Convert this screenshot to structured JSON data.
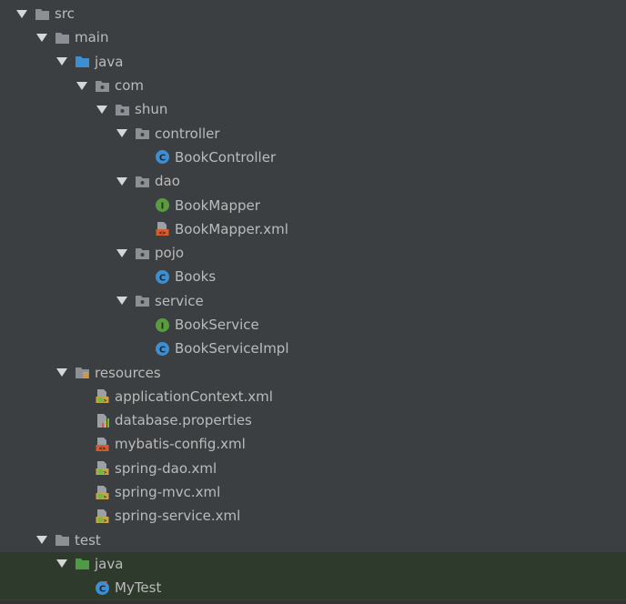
{
  "colors": {
    "background": "#3c3f41",
    "selected_row": "#2d3a2c",
    "text": "#bbbbbb",
    "folder": "#8c9095",
    "source_folder": "#3d8fd2",
    "test_folder": "#4f9a45",
    "class_badge": "#3d8fd2",
    "interface_badge": "#5a9b3d",
    "xml_badge": "#d35c30"
  },
  "tree": [
    {
      "label": "src",
      "depth": 0,
      "icon": "folder-icon",
      "expanded": true
    },
    {
      "label": "main",
      "depth": 1,
      "icon": "folder-icon",
      "expanded": true
    },
    {
      "label": "java",
      "depth": 2,
      "icon": "source-folder-icon",
      "expanded": true
    },
    {
      "label": "com",
      "depth": 3,
      "icon": "package-icon",
      "expanded": true
    },
    {
      "label": "shun",
      "depth": 4,
      "icon": "package-icon",
      "expanded": true
    },
    {
      "label": "controller",
      "depth": 5,
      "icon": "package-icon",
      "expanded": true
    },
    {
      "label": "BookController",
      "depth": 6,
      "icon": "class-icon",
      "leaf": true
    },
    {
      "label": "dao",
      "depth": 5,
      "icon": "package-icon",
      "expanded": true
    },
    {
      "label": "BookMapper",
      "depth": 6,
      "icon": "interface-icon",
      "leaf": true
    },
    {
      "label": "BookMapper.xml",
      "depth": 6,
      "icon": "xml-file-icon",
      "leaf": true
    },
    {
      "label": "pojo",
      "depth": 5,
      "icon": "package-icon",
      "expanded": true
    },
    {
      "label": "Books",
      "depth": 6,
      "icon": "class-icon",
      "leaf": true
    },
    {
      "label": "service",
      "depth": 5,
      "icon": "package-icon",
      "expanded": true
    },
    {
      "label": "BookService",
      "depth": 6,
      "icon": "interface-icon",
      "leaf": true
    },
    {
      "label": "BookServiceImpl",
      "depth": 6,
      "icon": "class-icon",
      "leaf": true
    },
    {
      "label": "resources",
      "depth": 2,
      "icon": "resources-folder-icon",
      "expanded": true
    },
    {
      "label": "applicationContext.xml",
      "depth": 3,
      "icon": "spring-xml-icon",
      "leaf": true
    },
    {
      "label": "database.properties",
      "depth": 3,
      "icon": "properties-file-icon",
      "leaf": true
    },
    {
      "label": "mybatis-config.xml",
      "depth": 3,
      "icon": "xml-file-icon",
      "leaf": true
    },
    {
      "label": "spring-dao.xml",
      "depth": 3,
      "icon": "spring-xml-icon",
      "leaf": true
    },
    {
      "label": "spring-mvc.xml",
      "depth": 3,
      "icon": "spring-xml-icon",
      "leaf": true
    },
    {
      "label": "spring-service.xml",
      "depth": 3,
      "icon": "spring-xml-icon",
      "leaf": true
    },
    {
      "label": "test",
      "depth": 1,
      "icon": "folder-icon",
      "expanded": true
    },
    {
      "label": "java",
      "depth": 2,
      "icon": "test-folder-icon",
      "expanded": true,
      "selected": true
    },
    {
      "label": "MyTest",
      "depth": 3,
      "icon": "test-class-icon",
      "leaf": true,
      "selected": true
    }
  ]
}
